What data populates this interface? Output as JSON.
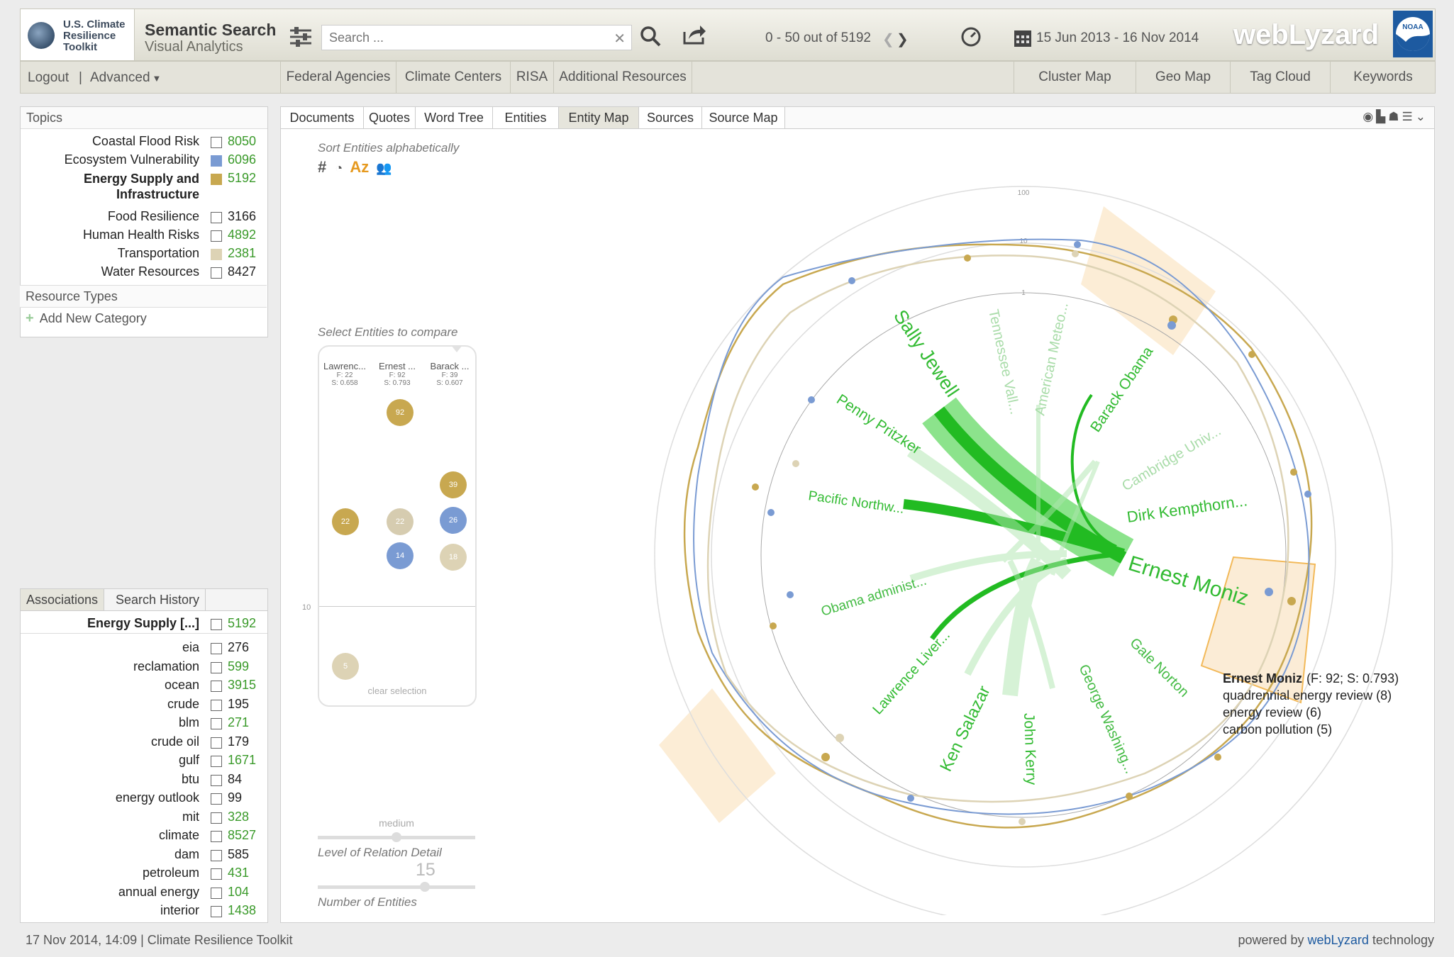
{
  "header": {
    "logo_text": "U.S. Climate Resilience Toolkit",
    "title": "Semantic Search",
    "subtitle": "Visual Analytics",
    "search_placeholder": "Search ...",
    "result_count": "0 - 50 out of 5192",
    "date_range": "15 Jun 2013 - 16 Nov 2014",
    "brand": "webLyzard",
    "noaa": "NOAA"
  },
  "nav": {
    "logout": "Logout",
    "advanced": "Advanced",
    "sources": [
      "Federal Agencies",
      "Climate Centers",
      "RISA",
      "Additional Resources"
    ],
    "views": [
      "Cluster Map",
      "Geo Map",
      "Tag Cloud",
      "Keywords"
    ]
  },
  "topics": {
    "heading": "Topics",
    "items": [
      {
        "label": "Coastal Flood Risk",
        "count": "8050",
        "color": "#ffffff",
        "count_color": "#3a9a2a"
      },
      {
        "label": "Ecosystem Vulnerability",
        "count": "6096",
        "color": "#7a9bd3",
        "count_color": "#3a9a2a"
      },
      {
        "label": "Energy Supply and Infrastructure",
        "count": "5192",
        "color": "#c8a850",
        "count_color": "#3a9a2a"
      },
      {
        "label": "Food Resilience",
        "count": "3166",
        "color": "#ffffff",
        "count_color": "#222222"
      },
      {
        "label": "Human Health Risks",
        "count": "4892",
        "color": "#ffffff",
        "count_color": "#3a9a2a"
      },
      {
        "label": "Transportation",
        "count": "2381",
        "color": "#ddd3b5",
        "count_color": "#3a9a2a"
      },
      {
        "label": "Water Resources",
        "count": "8427",
        "color": "#ffffff",
        "count_color": "#222222"
      }
    ],
    "resource_types": "Resource Types",
    "add_category": "Add New Category"
  },
  "associations": {
    "tabs": [
      "Associations",
      "Search History"
    ],
    "header_label": "Energy Supply [...]",
    "header_count": "5192",
    "items": [
      {
        "label": "eia",
        "count": "276",
        "count_color": "#222222"
      },
      {
        "label": "reclamation",
        "count": "599",
        "count_color": "#3a9a2a"
      },
      {
        "label": "ocean",
        "count": "3915",
        "count_color": "#3a9a2a"
      },
      {
        "label": "crude",
        "count": "195",
        "count_color": "#222222"
      },
      {
        "label": "blm",
        "count": "271",
        "count_color": "#3a9a2a"
      },
      {
        "label": "crude oil",
        "count": "179",
        "count_color": "#222222"
      },
      {
        "label": "gulf",
        "count": "1671",
        "count_color": "#3a9a2a"
      },
      {
        "label": "btu",
        "count": "84",
        "count_color": "#222222"
      },
      {
        "label": "energy outlook",
        "count": "99",
        "count_color": "#222222"
      },
      {
        "label": "mit",
        "count": "328",
        "count_color": "#3a9a2a"
      },
      {
        "label": "climate",
        "count": "8527",
        "count_color": "#3a9a2a"
      },
      {
        "label": "dam",
        "count": "585",
        "count_color": "#222222"
      },
      {
        "label": "petroleum",
        "count": "431",
        "count_color": "#3a9a2a"
      },
      {
        "label": "annual energy",
        "count": "104",
        "count_color": "#3a9a2a"
      },
      {
        "label": "interior",
        "count": "1438",
        "count_color": "#3a9a2a"
      }
    ]
  },
  "main": {
    "tabs": [
      "Documents",
      "Quotes",
      "Word Tree",
      "Entities",
      "Entity Map",
      "Sources",
      "Source Map"
    ],
    "active_tab": "Entity Map",
    "sort_label": "Sort Entities alphabetically",
    "sort_az": "Az",
    "compare_label": "Select Entities to compare",
    "compare_columns": [
      {
        "name": "Lawrenc...",
        "f": "F: 22",
        "s": "S: 0.658"
      },
      {
        "name": "Ernest ...",
        "f": "F: 92",
        "s": "S: 0.793"
      },
      {
        "name": "Barack ...",
        "f": "F: 39",
        "s": "S: 0.607"
      }
    ],
    "bubbles": [
      {
        "value": "92",
        "color": "#c8a850"
      },
      {
        "value": "39",
        "color": "#c8a850"
      },
      {
        "value": "22",
        "color": "#c8a850"
      },
      {
        "value": "22",
        "color": "#d6ccb0"
      },
      {
        "value": "26",
        "color": "#7a9bd3"
      },
      {
        "value": "18",
        "color": "#ddd3b5"
      },
      {
        "value": "14",
        "color": "#7a9bd3"
      },
      {
        "value": "5",
        "color": "#ddd3b5"
      }
    ],
    "axis_label_10": "10",
    "clear_selection": "clear selection",
    "slider_medium": "medium",
    "relation_detail_label": "Level of Relation Detail",
    "entity_count": "15",
    "entity_count_label": "Number of Entities",
    "ring_labels": [
      "100",
      "10",
      "1"
    ],
    "entities": [
      {
        "name": "Tennessee Vall...",
        "faded": true
      },
      {
        "name": "American Meteo...",
        "faded": true
      },
      {
        "name": "Barack Obama",
        "faded": false
      },
      {
        "name": "Cambridge Univ...",
        "faded": true
      },
      {
        "name": "Dirk Kempthorn...",
        "faded": false
      },
      {
        "name": "Ernest Moniz",
        "faded": false
      },
      {
        "name": "Gale Norton",
        "faded": false
      },
      {
        "name": "George Washing...",
        "faded": false
      },
      {
        "name": "John Kerry",
        "faded": false
      },
      {
        "name": "Ken Salazar",
        "faded": false
      },
      {
        "name": "Lawrence Liver...",
        "faded": false
      },
      {
        "name": "Obama administ...",
        "faded": false
      },
      {
        "name": "Pacific Northw...",
        "faded": false
      },
      {
        "name": "Penny Pritzker",
        "faded": false
      },
      {
        "name": "Sally Jewell",
        "faded": false
      }
    ],
    "tooltip": {
      "title": "Ernest Moniz",
      "stats": "(F: 92; S: 0.793)",
      "lines": [
        "quadrennial energy review (8)",
        "energy review (6)",
        "carbon pollution (5)"
      ]
    }
  },
  "footer": {
    "status": "17 Nov 2014, 14:09 | Climate Resilience Toolkit",
    "powered_prefix": "powered by",
    "powered_brand": "webLyzard",
    "powered_suffix": "technology"
  }
}
